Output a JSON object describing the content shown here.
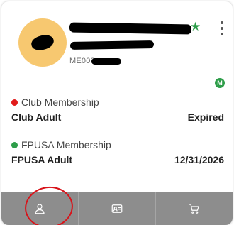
{
  "header": {
    "member_id_prefix": "ME000",
    "favorite_icon": "star-icon",
    "menu_icon": "more-vertical-icon",
    "avatar_color": "#F7C870"
  },
  "badge": {
    "label": "M",
    "color": "#2e9e4a"
  },
  "memberships": [
    {
      "title": "Club Membership",
      "status_color": "#e11b1b",
      "plan": "Club Adult",
      "value": "Expired"
    },
    {
      "title": "FPUSA Membership",
      "status_color": "#2e9e4a",
      "plan": "FPUSA Adult",
      "value": "12/31/2026"
    }
  ],
  "bottom_nav": [
    {
      "icon": "user-icon"
    },
    {
      "icon": "id-card-icon"
    },
    {
      "icon": "shopping-cart-icon"
    }
  ]
}
